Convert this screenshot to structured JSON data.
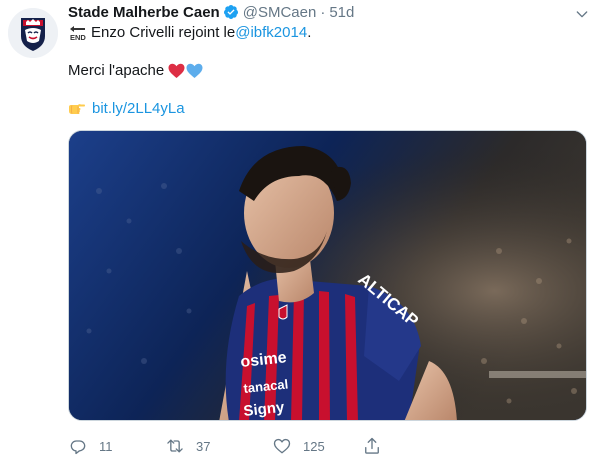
{
  "author": {
    "name": "Stade Malherbe Caen",
    "handle": "@SMCaen",
    "separator": "·",
    "time": "51d",
    "verified": true,
    "avatar_icon": "smcaen-crest-icon"
  },
  "tweet": {
    "line1_prefix": "Enzo Crivelli rejoint le ",
    "line1_mention": "@ibfk2014",
    "line1_suffix": ".",
    "line2_text": "Merci l'apache",
    "line3_link": "bit.ly/2LL4yLa",
    "emojis": [
      "end-arrow-icon",
      "red-heart-icon",
      "blue-heart-icon",
      "backhand-index-pointing-right-icon"
    ]
  },
  "media": {
    "alt_icon": "player-photo"
  },
  "actions": {
    "reply_count": "11",
    "retweet_count": "37",
    "like_count": "125"
  },
  "colors": {
    "link": "#1b95e0",
    "secondary": "#657786",
    "verified": "#1da1f2",
    "heart_red": "#dd2e44",
    "heart_blue": "#5dadec"
  }
}
